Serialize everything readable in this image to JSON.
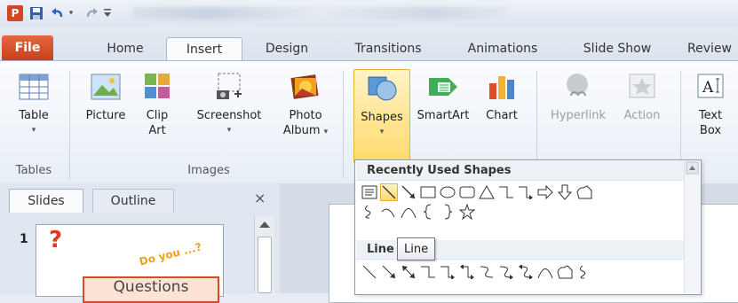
{
  "window": {
    "app_icon_letter": "P"
  },
  "tabs": {
    "file": "File",
    "items": [
      "Home",
      "Insert",
      "Design",
      "Transitions",
      "Animations",
      "Slide Show",
      "Review"
    ]
  },
  "ribbon": {
    "tables": {
      "table": "Table",
      "group": "Tables"
    },
    "images": {
      "picture": "Picture",
      "clip_art_1": "Clip",
      "clip_art_2": "Art",
      "screenshot": "Screenshot",
      "photo_album_1": "Photo",
      "photo_album_2": "Album",
      "group": "Images"
    },
    "illustrations": {
      "shapes": "Shapes",
      "smartart": "SmartArt",
      "chart": "Chart"
    },
    "links": {
      "hyperlink": "Hyperlink",
      "action": "Action"
    },
    "text": {
      "text_box_1": "Text",
      "text_box_2": "Box"
    },
    "caret": "▾"
  },
  "pane": {
    "tab_slides": "Slides",
    "tab_outline": "Outline",
    "close": "×",
    "slide_number": "1",
    "thumb_question_mark": "?",
    "thumb_tagline": "Do you ...?",
    "thumb_title": "Questions"
  },
  "shapes_menu": {
    "recent_header": "Recently Used Shapes",
    "lines_header": "Line",
    "tooltip": "Line",
    "recent_row1": [
      "text-box",
      "line",
      "arrow-line",
      "rectangle",
      "oval",
      "rounded-rectangle",
      "triangle",
      "elbow-connector",
      "elbow-arrow-connector",
      "right-arrow",
      "down-arrow",
      "snip-shape"
    ],
    "recent_row2": [
      "freeform",
      "curve",
      "arc",
      "left-brace",
      "right-brace",
      "star"
    ],
    "lines_row": [
      "line",
      "arrow",
      "double-arrow",
      "elbow",
      "elbow-arrow",
      "elbow-double-arrow",
      "curved-connector",
      "curved-arrow",
      "curved-double-arrow",
      "curve",
      "freeform",
      "scribble"
    ]
  },
  "colors": {
    "file_tab": "#d24726",
    "hover_yellow": "#ffd96a"
  }
}
